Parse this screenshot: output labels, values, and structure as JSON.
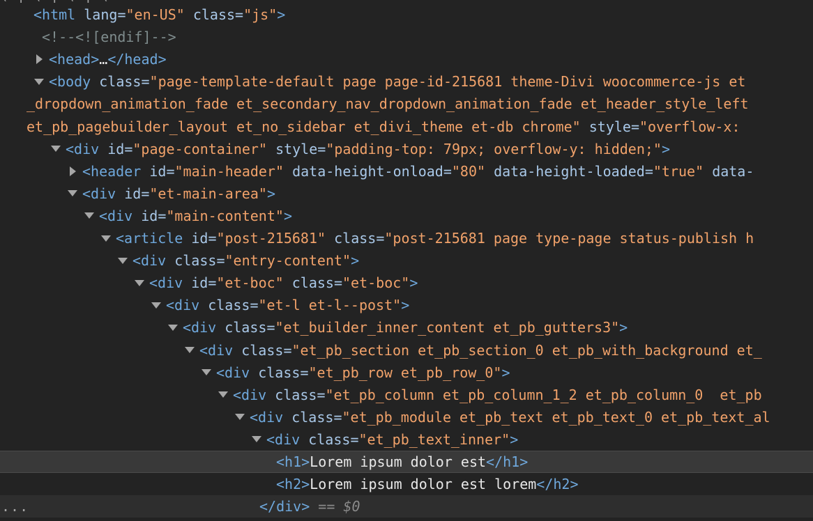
{
  "panel": "Elements",
  "dom_tree": {
    "partial_top_line": "( | ( | ( | (",
    "lines": [
      {
        "code": "<html lang=\"en-US\" class=\"js\">",
        "toggle": "none"
      },
      {
        "code": "<!--<![endif]-->",
        "toggle": "none"
      },
      {
        "code": "<head>…</head>",
        "toggle": "collapsed"
      },
      {
        "code": "<body class=\"page-template-default page page-id-215681 theme-Divi woocommerce-js et",
        "toggle": "expanded"
      },
      {
        "code": "_dropdown_animation_fade et_secondary_nav_dropdown_animation_fade et_header_style_left",
        "toggle": "none"
      },
      {
        "code": "et_pb_pagebuilder_layout et_no_sidebar et_divi_theme et-db chrome\" style=\"overflow-x:",
        "toggle": "none"
      },
      {
        "code": "<div id=\"page-container\" style=\"padding-top: 79px; overflow-y: hidden;\">",
        "toggle": "expanded"
      },
      {
        "code": "<header id=\"main-header\" data-height-onload=\"80\" data-height-loaded=\"true\" data-",
        "toggle": "collapsed"
      },
      {
        "code": "<div id=\"et-main-area\">",
        "toggle": "expanded"
      },
      {
        "code": "<div id=\"main-content\">",
        "toggle": "expanded"
      },
      {
        "code": "<article id=\"post-215681\" class=\"post-215681 page type-page status-publish h",
        "toggle": "expanded"
      },
      {
        "code": "<div class=\"entry-content\">",
        "toggle": "expanded"
      },
      {
        "code": "<div id=\"et-boc\" class=\"et-boc\">",
        "toggle": "expanded"
      },
      {
        "code": "<div class=\"et-l et-l--post\">",
        "toggle": "expanded"
      },
      {
        "code": "<div class=\"et_builder_inner_content et_pb_gutters3\">",
        "toggle": "expanded"
      },
      {
        "code": "<div class=\"et_pb_section et_pb_section_0 et_pb_with_background et_",
        "toggle": "expanded"
      },
      {
        "code": "<div class=\"et_pb_row et_pb_row_0\">",
        "toggle": "expanded"
      },
      {
        "code": "<div class=\"et_pb_column et_pb_column_1_2 et_pb_column_0  et_pb",
        "toggle": "expanded"
      },
      {
        "code": "<div class=\"et_pb_module et_pb_text et_pb_text_0 et_pb_text_al",
        "toggle": "expanded"
      },
      {
        "code": "<div class=\"et_pb_text_inner\">",
        "toggle": "expanded"
      },
      {
        "code": "<h1>Lorem ipsum dolor est</h1>",
        "toggle": "none",
        "selected": true
      },
      {
        "code": "<h2>Lorem ipsum dolor est lorem</h2>",
        "toggle": "none"
      },
      {
        "code": "</div> == $0",
        "toggle": "none",
        "last": true
      }
    ],
    "ellipsis": "..."
  },
  "colors": {
    "background": "#232323",
    "tag": "#6fa8dc",
    "attr_name": "#a9c8e8",
    "attr_value": "#f1a26a",
    "text": "#e8e8e8",
    "selected_bg": "#393939"
  }
}
